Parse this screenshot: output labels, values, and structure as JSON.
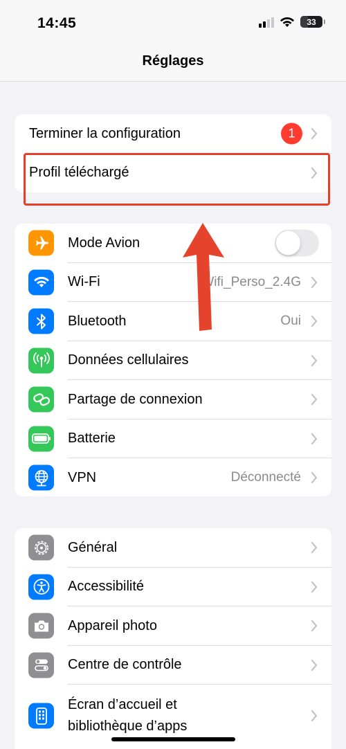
{
  "status": {
    "time": "14:45",
    "battery": "33",
    "battery_level": 0.33
  },
  "nav": {
    "title": "Réglages"
  },
  "setup": [
    {
      "label": "Terminer la configuration",
      "badge": "1"
    },
    {
      "label": "Profil téléchargé"
    }
  ],
  "connectivity": [
    {
      "label": "Mode Avion",
      "icon": "airplane-icon",
      "color": "#ff9500",
      "toggle": false
    },
    {
      "label": "Wi-Fi",
      "icon": "wifi-icon",
      "color": "#007aff",
      "value": "Wifi_Perso_2.4G"
    },
    {
      "label": "Bluetooth",
      "icon": "bluetooth-icon",
      "color": "#007aff",
      "value": "Oui"
    },
    {
      "label": "Données cellulaires",
      "icon": "antenna-icon",
      "color": "#34c759"
    },
    {
      "label": "Partage de connexion",
      "icon": "link-icon",
      "color": "#34c759"
    },
    {
      "label": "Batterie",
      "icon": "battery-icon",
      "color": "#34c759"
    },
    {
      "label": "VPN",
      "icon": "globe-icon",
      "color": "#007aff",
      "value": "Déconnecté"
    }
  ],
  "general": [
    {
      "label": "Général",
      "icon": "gear-icon",
      "color": "#8e8e93"
    },
    {
      "label": "Accessibilité",
      "icon": "accessibility-icon",
      "color": "#007aff"
    },
    {
      "label": "Appareil photo",
      "icon": "camera-icon",
      "color": "#8e8e93"
    },
    {
      "label": "Centre de contrôle",
      "icon": "control-center-icon",
      "color": "#8e8e93"
    },
    {
      "label_line1": "Écran d’accueil et",
      "label_line2": "bibliothèque d’apps",
      "icon": "home-screen-icon",
      "color": "#007aff"
    }
  ],
  "annotation": {
    "highlight_color": "#e53e2b"
  }
}
